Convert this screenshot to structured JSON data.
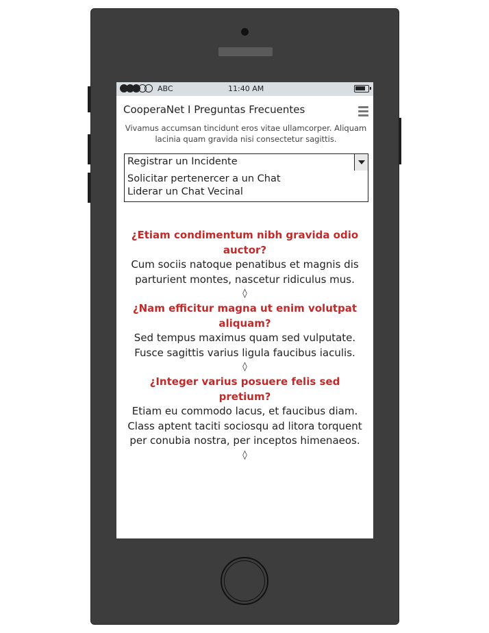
{
  "status_bar": {
    "carrier": "ABC",
    "time": "11:40 AM",
    "signal_filled": 3,
    "signal_total": 5
  },
  "header": {
    "title": "CooperaNet I Preguntas Frecuentes",
    "menu_icon": "hamburger-menu-icon"
  },
  "intro": "Vivamus accumsan tincidunt eros vitae ullamcorper. Aliquam lacinia quam gravida nisi consectetur sagittis.",
  "select": {
    "value": "Registrar un Incidente",
    "options": [
      "Solicitar pertenercer a un Chat",
      "Liderar un Chat Vecinal"
    ]
  },
  "faqs": [
    {
      "question": "¿Etiam condimentum nibh gravida odio auctor?",
      "answer": "Cum sociis natoque penatibus et magnis dis parturient montes, nascetur ridiculus mus.",
      "separator": "◊"
    },
    {
      "question": "¿Nam efficitur magna ut enim volutpat aliquam?",
      "answer": "Sed tempus maximus quam sed vulputate. Fusce sagittis varius ligula faucibus iaculis.",
      "separator": "◊"
    },
    {
      "question": "¿Integer varius posuere felis sed pretium?",
      "answer": "Etiam eu commodo lacus, et faucibus diam. Class aptent taciti sociosqu ad litora torquent per conubia nostra, per inceptos himenaeos.",
      "separator": "◊"
    }
  ],
  "colors": {
    "question": "#c22a2a",
    "status_bar": "#d9dee2",
    "phone_body": "#3d3d3d"
  }
}
